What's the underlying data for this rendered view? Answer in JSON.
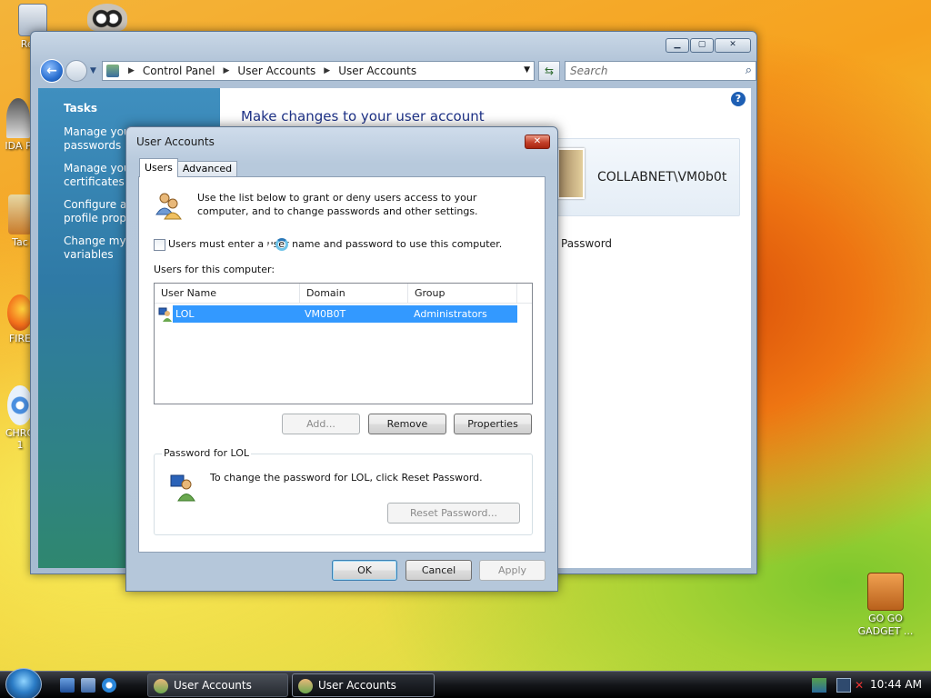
{
  "desktop": {
    "icons": [
      {
        "label": "Recy"
      },
      {
        "label": "IDA P"
      },
      {
        "label": "Tac"
      },
      {
        "label": "FIRE"
      },
      {
        "label": "CHRO"
      },
      {
        "label": "1"
      }
    ],
    "gadget_label": "GO GO\nGADGET ..."
  },
  "control_panel": {
    "breadcrumb": [
      "Control Panel",
      "User Accounts",
      "User Accounts"
    ],
    "search_placeholder": "Search",
    "tasks_heading": "Tasks",
    "tasks": [
      "Manage your\npasswords",
      "Manage your\ncertificates",
      "Configure ad\nprofile prope",
      "Change my e\nvariables"
    ],
    "page_title": "Make changes to your user account",
    "user_account": "COLLABNET\\VM0b0t",
    "password_link": "Password",
    "help_glyph": "?"
  },
  "dialog": {
    "title": "User Accounts",
    "tabs": [
      {
        "label": "Users",
        "active": true
      },
      {
        "label": "Advanced",
        "active": false
      }
    ],
    "intro_text": "Use the list below to grant or deny users access to your computer, and to change passwords and other settings.",
    "checkbox_label": "Users must enter a user name and password to use this computer.",
    "checkbox_checked": false,
    "users_label": "Users for this computer:",
    "columns": [
      "User Name",
      "Domain",
      "Group"
    ],
    "rows": [
      {
        "user_name": "LOL",
        "domain": "VM0B0T",
        "group": "Administrators",
        "selected": true
      }
    ],
    "buttons": {
      "add": "Add...",
      "remove": "Remove",
      "properties": "Properties"
    },
    "password_group_label": "Password for LOL",
    "password_text": "To change the password for LOL, click Reset Password.",
    "reset_password": "Reset Password...",
    "ok": "OK",
    "cancel": "Cancel",
    "apply": "Apply"
  },
  "taskbar": {
    "buttons": [
      "User Accounts",
      "User Accounts"
    ],
    "clock": "10:44 AM"
  },
  "colors": {
    "selection": "#3399ff",
    "link_title": "#1e3287",
    "tasks_panel": "#2f7aa6"
  }
}
